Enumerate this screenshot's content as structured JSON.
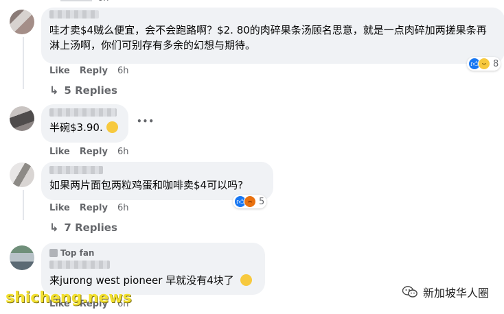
{
  "comments": [
    {
      "author_visible": "",
      "text": "哇才卖$4贼么便宜，会不会跑路啊？$2. 80的肉碎果条汤顾名思意，就是一点肉碎加两搓果条再淋上汤啊，你们可别存有多余的幻想与期待。",
      "like_label": "Like",
      "reply_label": "Reply",
      "time": "6h",
      "reaction_count": "8",
      "replies_label": "5 Replies"
    },
    {
      "author_visible": "",
      "text": "半碗$3.90.",
      "like_label": "Like",
      "reply_label": "Reply",
      "time": "6h"
    },
    {
      "author_visible": "",
      "text": "如果两片面包两粒鸡蛋和咖啡卖$4可以吗?",
      "like_label": "Like",
      "reply_label": "Reply",
      "time": "6h",
      "reaction_count": "5",
      "replies_label": "7 Replies"
    },
    {
      "badge": "Top fan",
      "text": "来jurong west pioneer 早就没有4块了",
      "like_label": "Like",
      "reply_label": "Reply",
      "time": "6h"
    }
  ],
  "top_time": "6h",
  "more_label": "•••",
  "watermark_left": "shicheng.news",
  "watermark_right": "新加坡华人圈",
  "colors": {
    "bubble": "#f0f2f5",
    "meta": "#65676b",
    "like_blue": "#1877f2",
    "haha": "#f7c93e",
    "angry": "#e9710f"
  }
}
